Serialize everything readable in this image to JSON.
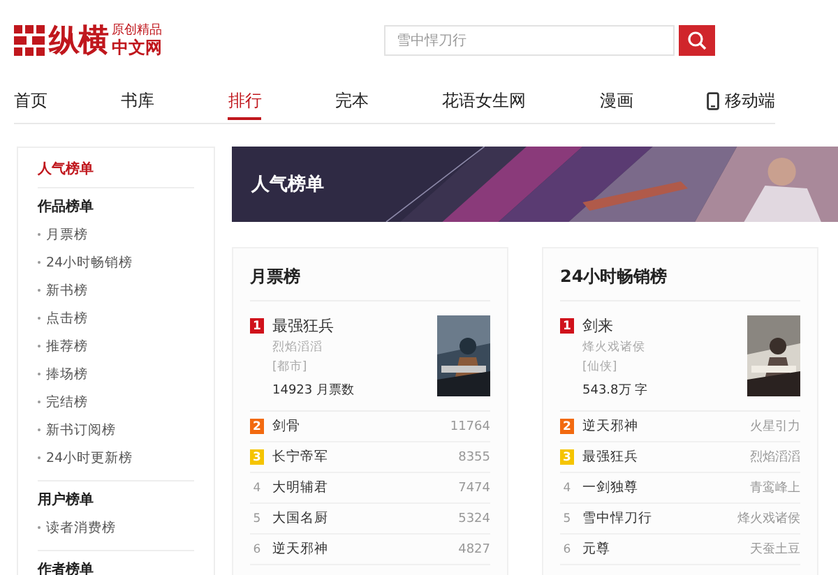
{
  "logo": {
    "name": "纵横",
    "tagline": "原创精品",
    "site": "中文网"
  },
  "search": {
    "placeholder": "雪中悍刀行"
  },
  "nav": [
    {
      "label": "首页",
      "selected": false,
      "kind": "text"
    },
    {
      "label": "书库",
      "selected": false,
      "kind": "text"
    },
    {
      "label": "排行",
      "selected": true,
      "kind": "text"
    },
    {
      "label": "完本",
      "selected": false,
      "kind": "text"
    },
    {
      "label": "花语女生网",
      "selected": false,
      "kind": "text"
    },
    {
      "label": "漫画",
      "selected": false,
      "kind": "text"
    },
    {
      "label": "移动端",
      "selected": false,
      "kind": "mobile"
    }
  ],
  "sidebar": {
    "title": "人气榜单",
    "groups": [
      {
        "heading": "作品榜单",
        "items": [
          "月票榜",
          "24小时畅销榜",
          "新书榜",
          "点击榜",
          "推荐榜",
          "捧场榜",
          "完结榜",
          "新书订阅榜",
          "24小时更新榜"
        ]
      },
      {
        "heading": "用户榜单",
        "items": [
          "读者消费榜"
        ]
      },
      {
        "heading": "作者榜单"
      }
    ]
  },
  "banner": {
    "title": "人气榜单"
  },
  "rankings": [
    {
      "title": "月票榜",
      "top": {
        "rank": "1",
        "color": "#d0111b",
        "title": "最强狂兵",
        "author": "烈焰滔滔",
        "genre": "[都市]",
        "stat": "14923 月票数"
      },
      "rows": [
        {
          "rank": "2",
          "kind": "badge",
          "color": "#f26a10",
          "title": "剑骨",
          "info": "11764"
        },
        {
          "rank": "3",
          "kind": "badge",
          "color": "#f5c400",
          "title": "长宁帝军",
          "info": "8355"
        },
        {
          "rank": "4",
          "kind": "plain",
          "title": "大明辅君",
          "info": "7474"
        },
        {
          "rank": "5",
          "kind": "plain",
          "title": "大国名厨",
          "info": "5324"
        },
        {
          "rank": "6",
          "kind": "plain",
          "title": "逆天邪神",
          "info": "4827"
        }
      ]
    },
    {
      "title": "24小时畅销榜",
      "top": {
        "rank": "1",
        "color": "#d0111b",
        "title": "剑来",
        "author": "烽火戏诸侯",
        "genre": "[仙侠]",
        "stat": "543.8万 字"
      },
      "rows": [
        {
          "rank": "2",
          "kind": "badge",
          "color": "#f26a10",
          "title": "逆天邪神",
          "info": "火星引力"
        },
        {
          "rank": "3",
          "kind": "badge",
          "color": "#f5c400",
          "title": "最强狂兵",
          "info": "烈焰滔滔"
        },
        {
          "rank": "4",
          "kind": "plain",
          "title": "一剑独尊",
          "info": "青鸾峰上"
        },
        {
          "rank": "5",
          "kind": "plain",
          "title": "雪中悍刀行",
          "info": "烽火戏诸侯"
        },
        {
          "rank": "6",
          "kind": "plain",
          "title": "元尊",
          "info": "天蚕土豆"
        }
      ]
    }
  ]
}
